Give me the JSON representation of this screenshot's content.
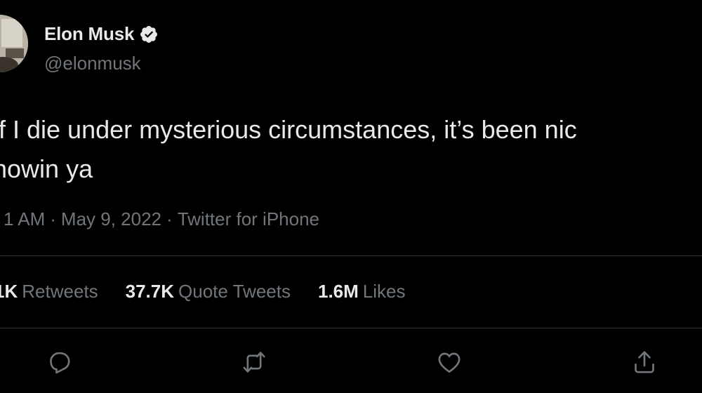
{
  "author": {
    "display_name": "Elon Musk",
    "handle": "@elonmusk",
    "verified_icon": "verified-badge-icon",
    "avatar": "profile-photo"
  },
  "tweet": {
    "line1": "f I die under mysterious circumstances, it’s been nic",
    "line2": "nowin ya"
  },
  "meta": {
    "time": "1 AM",
    "date": "May 9, 2022",
    "source": "Twitter for iPhone",
    "separator": "·"
  },
  "stats": [
    {
      "value": "1K",
      "label": "Retweets"
    },
    {
      "value": "37.7K",
      "label": "Quote Tweets"
    },
    {
      "value": "1.6M",
      "label": "Likes"
    }
  ],
  "actions": {
    "reply_icon": "reply-icon",
    "retweet_icon": "retweet-icon",
    "like_icon": "heart-icon",
    "share_icon": "share-icon"
  },
  "colors": {
    "background": "#000000",
    "primary_text": "#e7e9ea",
    "secondary_text": "#71767b",
    "divider": "#2f3336"
  }
}
